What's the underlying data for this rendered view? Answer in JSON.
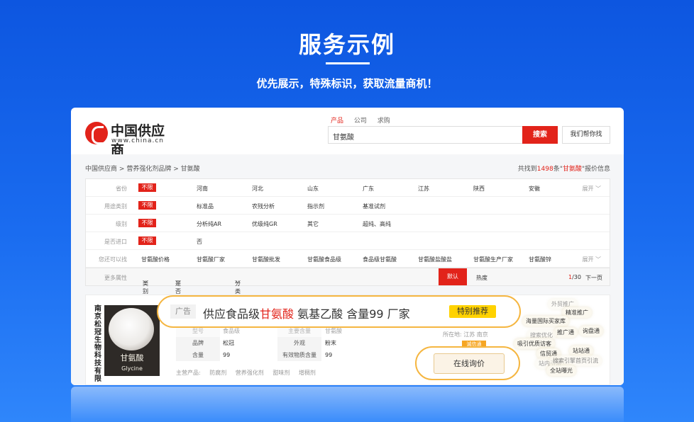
{
  "hero": {
    "title": "服务示例",
    "subtitle": "优先展示，特殊标识，获取流量商机！"
  },
  "header": {
    "logo_name": "中国供应商",
    "logo_url": "www.china.cn",
    "search_tabs": [
      "产品",
      "公司",
      "求购"
    ],
    "search_value": "甘氨酸",
    "search_button": "搜索",
    "help_button": "我们帮你找"
  },
  "breadcrumb": [
    "中国供应商",
    "营养强化剂品牌",
    "甘氨酸"
  ],
  "breadcrumb_sep": ">",
  "result_count": {
    "prefix": "共找到",
    "count": "1498",
    "mid": "条\"",
    "keyword": "甘氨酸",
    "suffix": "\"报价信息"
  },
  "filters": [
    {
      "label": "省份",
      "tag": "不限",
      "options": [
        "河南",
        "河北",
        "山东",
        "广东",
        "江苏",
        "陕西",
        "安徽"
      ],
      "more": "展开"
    },
    {
      "label": "用途类别",
      "tag": "不限",
      "options": [
        "标准品",
        "农残分析",
        "指示剂",
        "基准试剂"
      ],
      "more": ""
    },
    {
      "label": "级别",
      "tag": "不限",
      "options": [
        "分析纯AR",
        "优级纯GR",
        "其它",
        "超纯、高纯"
      ],
      "more": ""
    },
    {
      "label": "是否进口",
      "tag": "不限",
      "options": [
        "否"
      ],
      "more": ""
    },
    {
      "label": "您还可以找",
      "tag": "",
      "options": [
        "甘氨酸价格",
        "甘氨酸厂家",
        "甘氨酸批发",
        "甘氨酸食品级",
        "食品级甘氨酸",
        "甘氨酸盐酸盐",
        "甘氨酸生产厂家",
        "甘氨酸锌"
      ],
      "more": "展开"
    }
  ],
  "sort_bar": {
    "more_attrs": "更多属性",
    "category": "类别",
    "hazardous": "是否危险化学品",
    "grade": "分类",
    "default": "默认",
    "popularity": "热度",
    "page_current": "1",
    "page_total": "/30",
    "next_page": "下一页"
  },
  "result": {
    "company_vertical": "南京松冠生物科技有限",
    "image_cn": "甘氨酸",
    "image_en": "Glycine",
    "spec_rows": [
      {
        "k1": "型号",
        "v1": "食品级",
        "k2": "主要含量",
        "v2": "甘氨酸",
        "faint": true
      },
      {
        "k1": "品牌",
        "v1": "松冠",
        "k2": "外观",
        "v2": "粉末",
        "faint": false
      },
      {
        "k1": "含量",
        "v1": "99",
        "k2": "有效物质含量",
        "v2": "99",
        "faint": false
      }
    ],
    "main_products_label": "主营产品:",
    "main_products": [
      "防腐剂",
      "营养强化剂",
      "甜味剂",
      "增稠剂"
    ],
    "location": "所在地: 江苏 南京",
    "gold_tag": "诚信通"
  },
  "promo_words": [
    "外贸推广",
    "精准推广",
    "海量国际买家库",
    "推广通",
    "询盘通",
    "搜索优化",
    "吸引优质访客",
    "信贸通",
    "站站通",
    "站内引流",
    "搜索引擎首页引流",
    "全站曝光"
  ],
  "ad": {
    "label": "广告",
    "text_before": "供应食品级",
    "highlight": "甘氨酸",
    "text_after": " 氨基乙酸 含量99 厂家",
    "badge": "特别推荐"
  },
  "inquiry_button": "在线询价",
  "colors": {
    "brand_red": "#e2231a",
    "accent_gold": "#f5b641",
    "badge_yellow": "#ffd200",
    "bg_blue": "#1a6cf0"
  }
}
